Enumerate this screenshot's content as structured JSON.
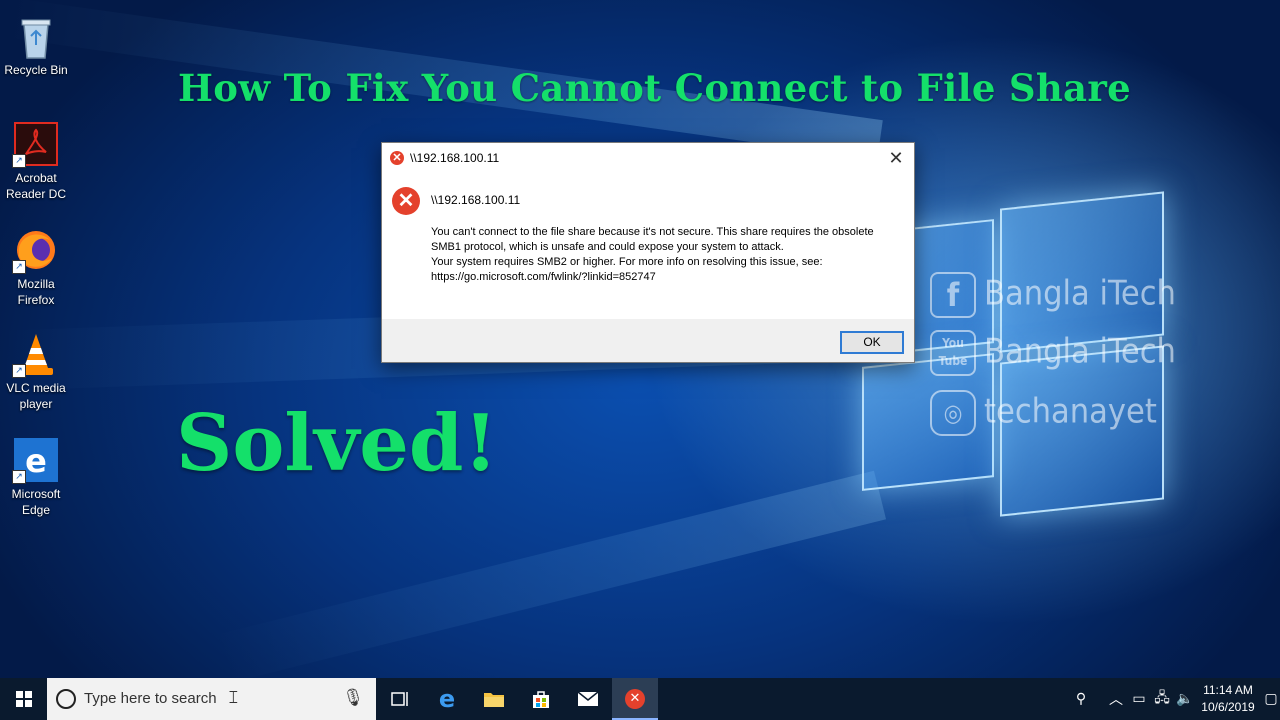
{
  "desktop": {
    "icons": [
      {
        "name": "recycle-bin",
        "label_lines": [
          "Recycle Bin"
        ]
      },
      {
        "name": "acrobat-reader-dc",
        "label_lines": [
          "Acrobat",
          "Reader DC"
        ]
      },
      {
        "name": "mozilla-firefox",
        "label_lines": [
          "Mozilla",
          "Firefox"
        ]
      },
      {
        "name": "vlc-media-player",
        "label_lines": [
          "VLC media",
          "player"
        ]
      },
      {
        "name": "microsoft-edge",
        "label_lines": [
          "Microsoft",
          "Edge"
        ]
      }
    ],
    "headline": "How To Fix You Cannot Connect to File Share",
    "solved": "Solved!",
    "watermark": {
      "facebook": "Bangla iTech",
      "youtube": "Bangla iTech",
      "youtube_badge_top": "You",
      "youtube_badge_bottom": "Tube",
      "instagram": "techanayet"
    }
  },
  "dialog": {
    "title": "\\\\192.168.100.11",
    "heading": "\\\\192.168.100.11",
    "message_lines": [
      "You can't connect to the file share because it's not secure. This share requires the obsolete",
      "SMB1 protocol, which is unsafe and could expose your system to attack.",
      "Your system requires SMB2 or higher. For more info on resolving this issue, see:",
      "https://go.microsoft.com/fwlink/?linkid=852747"
    ],
    "ok_label": "OK",
    "close_glyph": "✕"
  },
  "taskbar": {
    "search_placeholder": "Type here to search",
    "clock_time": "11:14 AM",
    "clock_date": "10/6/2019",
    "apps": [
      "task-view",
      "microsoft-edge",
      "file-explorer",
      "microsoft-store",
      "mail",
      "error-dialog"
    ],
    "active_app": "error-dialog"
  },
  "colors": {
    "headline_green": "#14e06a",
    "error_red": "#e4412c",
    "taskbar": "#0a1a2e",
    "desktop_blue": "#0b4fb0"
  }
}
